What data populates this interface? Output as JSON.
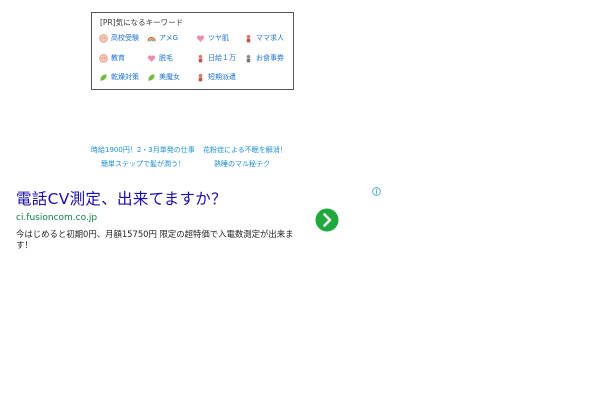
{
  "keyword_box": {
    "title": "[PR]気になるキーワード",
    "items": [
      {
        "label": "高校受験",
        "icon": "face-icon"
      },
      {
        "label": "アメG",
        "icon": "rainbow-icon"
      },
      {
        "label": "ツヤ肌",
        "icon": "heart-icon"
      },
      {
        "label": "ママ求人",
        "icon": "person-icon"
      },
      {
        "label": "教育",
        "icon": "face-icon"
      },
      {
        "label": "脱毛",
        "icon": "heart-icon"
      },
      {
        "label": "日給１万",
        "icon": "person-icon"
      },
      {
        "label": "お食事券",
        "icon": "person-icon"
      },
      {
        "label": "乾燥対策",
        "icon": "leaf-icon"
      },
      {
        "label": "美魔女",
        "icon": "leaf-icon"
      },
      {
        "label": "短期派遣",
        "icon": "person-icon"
      }
    ]
  },
  "promos": [
    "時給1900円！2・3月単発の仕事",
    "花粉症による不眠を解消！",
    "簡単ステップで髪が潤う！",
    "熟睡のマル秘テク"
  ],
  "ad": {
    "headline": "電話CV測定、出来てますか？",
    "url": "ci.fusioncom.co.jp",
    "description": "今はじめると初期0円、月額15750円 限定の超特価で入電数測定が出来ます！"
  },
  "colors": {
    "link": "#1a6fd6",
    "headline": "#1a0dab",
    "url": "#0b8043",
    "go_button": "#1fa83c"
  }
}
